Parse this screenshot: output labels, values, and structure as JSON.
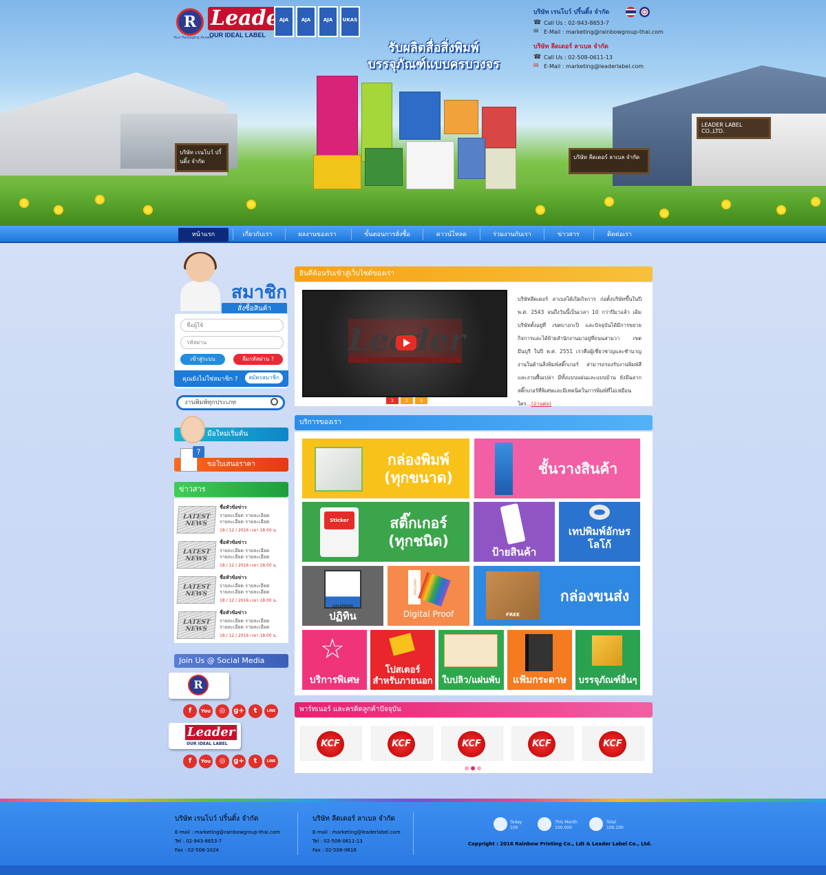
{
  "brand": {
    "logo_r_letter": "R",
    "logo_r_sub": "Your Packaging Answer",
    "logo_leader": "Leader",
    "logo_leader_sub": "OUR IDEAL LABEL",
    "certs": [
      "AJA",
      "AJA",
      "AJA",
      "UKAS"
    ]
  },
  "header": {
    "slogan_line1": "รับผลิตสื่อสิ่งพิมพ์",
    "slogan_line2": "บรรจุภัณฑ์แบบครบวงจร",
    "company1": {
      "name": "บริษัท เรนโบว์ ปริ้นติ้ง จำกัด",
      "call": "Call Us : 02-943-8653-7",
      "email": "E-Mail : marketing@rainbowgroup-thai.com"
    },
    "company2": {
      "name": "บริษัท ลีดเดอร์ ลาเบล จำกัด",
      "call": "Call Us : 02-508-0611-13",
      "email": "E-Mail : marketing@leaderlabel.com"
    },
    "sign_left": "บริษัท เรนโบว์ ปริ้นติ้ง จำกัด",
    "sign_mid": "บริษัท ลีดเดอร์ ลาเบล จำกัด",
    "sign_right_en": "LEADER LABEL CO.,LTD."
  },
  "nav": [
    "หน้าแรก",
    "เกี่ยวกับเรา",
    "ผลงานของเรา",
    "ขั้นตอนการสั่งซื้อ",
    "ดาวน์โหลด",
    "ร่วมงานกับเรา",
    "ข่าวสาร",
    "ติดต่อเรา"
  ],
  "member": {
    "title": "สมาชิก",
    "subtitle": "สั่งซื้อสินค้า",
    "username_placeholder": "ชื่อผู้ใช้",
    "password_placeholder": "รหัสผ่าน",
    "login": "เข้าสู่ระบบ",
    "forgot": "ลืมรหัสผ่าน ?",
    "not_member": "คุณยังไม่ใช่สมาชิก ?",
    "register": "สมัครสมาชิก"
  },
  "search": {
    "placeholder": "งานพิมพ์ทุกประเภท"
  },
  "side_banners": {
    "beginner": "มือใหม่เริ่มต้น",
    "quote": "ขอใบเสนอราคา"
  },
  "news": {
    "heading": "ข่าวสาร",
    "thumb_text": "LATEST NEWS",
    "items": [
      {
        "title": "ชื่อหัวข้อข่าว",
        "detail1": "รายละเอียด รายละเอียด",
        "detail2": "รายละเอียด รายละเอียด",
        "date": "18 / 12 / 2016 เวลา 18.00 น."
      },
      {
        "title": "ชื่อหัวข้อข่าว",
        "detail1": "รายละเอียด รายละเอียด",
        "detail2": "รายละเอียด รายละเอียด",
        "date": "18 / 12 / 2016 เวลา 18.00 น."
      },
      {
        "title": "ชื่อหัวข้อข่าว",
        "detail1": "รายละเอียด รายละเอียด",
        "detail2": "รายละเอียด รายละเอียด",
        "date": "18 / 12 / 2016 เวลา 18.00 น."
      },
      {
        "title": "ชื่อหัวข้อข่าว",
        "detail1": "รายละเอียด รายละเอียด",
        "detail2": "รายละเอียด รายละเอียด",
        "date": "18 / 12 / 2016 เวลา 18.00 น."
      }
    ]
  },
  "social": {
    "heading": "Join Us @ Social Media",
    "icons": [
      "f",
      "You",
      "◎",
      "g+",
      "t",
      "LINE"
    ]
  },
  "welcome": {
    "heading": "ยินดีต้อนรับเข้าสู่เว็บไซต์ของเรา",
    "video_logo": "Leader",
    "slides": [
      "1",
      "2",
      "3"
    ],
    "about": "บริษัทลีดเดอร์ ลาเบลได้เปิดกิจการ ก่อตั้งบริษัทขึ้นในปี พ.ศ. 2543 จนถึงวันนี้เป็นเวลา 10 กว่าปีมาแล้ว เดิมบริษัทตั้งอยู่ที่ เขตบางกะปิ และปัจจุบันได้มีการขยายกิจการและได้ย้ายสำนักงานมาอยู่ที่ถนนสามวา เขตมีนบุรี ในปี พ.ศ. 2551 เราคือผู้เชี่ยวชาญและชำนาญงานในด้านสิ่งพิมพ์สติ๊กเกอร์ สามารถรองรับงานพิมพ์สี และงานพื้นเปล่า มีทั้งแบบแผ่นและแบบม้วน ยังมีฉลากสติ๊กเกอร์ที่พิเศษและมีเทคนิคในการพิมพ์ที่ไม่เหมือนใคร...",
    "read_more": "(อ่านต่อ)"
  },
  "services": {
    "heading": "บริการของเรา",
    "tiles": [
      {
        "label1": "กล่องพิมพ์",
        "label2": "(ทุกขนาด)",
        "color": "#f9c21a"
      },
      {
        "label1": "ชั้นวางสินค้า",
        "label2": "",
        "color": "#f25fa4"
      },
      {
        "label1": "สติ๊กเกอร์",
        "label2": "(ทุกชนิด)",
        "color": "#3aa54a"
      },
      {
        "label1": "ป้ายสินค้า",
        "label2": "",
        "color": "#8f55c5"
      },
      {
        "label1": "เทปพิมพ์อักษร",
        "label2": "โลโก้",
        "color": "#2a73cf"
      },
      {
        "label1": "ปฏิทิน",
        "label2": "",
        "color": "#666666"
      },
      {
        "label1": "Digital Proof",
        "label2": "",
        "color": "#f58a4b"
      },
      {
        "label1": "กล่องขนส่ง",
        "label2": "",
        "color": "#2f88e2"
      },
      {
        "label1": "บริการพิเศษ",
        "label2": "",
        "color": "#f0347a"
      },
      {
        "label1": "โปสเตอร์",
        "label2": "สำหรับภายนอก",
        "color": "#e8262b"
      },
      {
        "label1": "ใบปลิว/แผ่นพับ",
        "label2": "",
        "color": "#2ea84d"
      },
      {
        "label1": "แฟ้มกระดาษ",
        "label2": "",
        "color": "#f47b20"
      },
      {
        "label1": "บรรจุภัณฑ์อื่นๆ",
        "label2": "",
        "color": "#2aa251"
      }
    ],
    "calendar_text": "CALENDAR",
    "pantone_text": "PANTONE",
    "sticker_text": "Sticker",
    "box_text": "FREE"
  },
  "partners": {
    "heading": "พาร์ทเนอร์ และครดิตลูกค้าปัจจุบัน",
    "logos": [
      "KCF",
      "KCF",
      "KCF",
      "KCF",
      "KCF"
    ]
  },
  "footer": {
    "company1": {
      "name": "บริษัท เรนโบว์ ปริ้นติ้ง จำกัด",
      "email": "E-mail : marketing@rainbowgroup-thai.com",
      "tel": "Tel : 02-943-8653-7",
      "fax": "Fax : 02-508-1024"
    },
    "company2": {
      "name": "บริษัท ลีดเดอร์ ลาเบล จำกัด",
      "email": "E-mail : marketing@leaderlabel.com",
      "tel": "Tel : 02-508-0611-13",
      "fax": "Fax : 02-508-0618"
    },
    "stats": [
      {
        "label": "Today",
        "value": "100"
      },
      {
        "label": "This Month",
        "value": "100.000"
      },
      {
        "label": "Total",
        "value": "100.100"
      }
    ],
    "copyright": "Copyright : 2016 Rainbow Printing Co., Ldt & Leader Label Co., Ltd."
  }
}
